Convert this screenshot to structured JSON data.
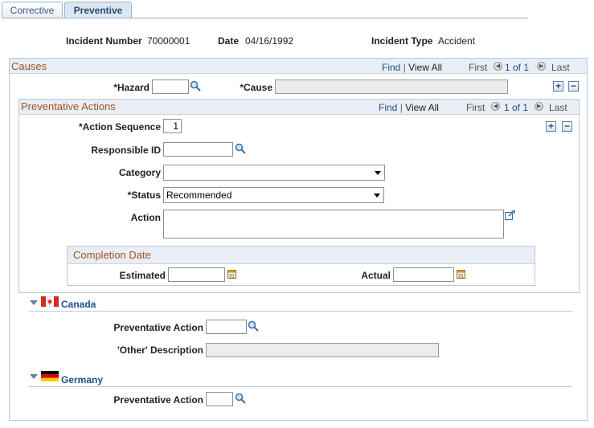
{
  "tabs": [
    {
      "label": "Corrective",
      "active": false
    },
    {
      "label": "Preventive",
      "active": true
    }
  ],
  "header": {
    "incident_number_label": "Incident Number",
    "incident_number_value": "70000001",
    "date_label": "Date",
    "date_value": "04/16/1992",
    "incident_type_label": "Incident Type",
    "incident_type_value": "Accident"
  },
  "causes": {
    "title": "Causes",
    "find": "Find",
    "sep": "|",
    "view_all": "View All",
    "first": "First",
    "count": "1 of 1",
    "last": "Last",
    "hazard_label": "*Hazard",
    "hazard_value": "",
    "cause_label": "*Cause",
    "cause_value": "",
    "add": "+",
    "remove": "−"
  },
  "preventative_actions": {
    "title": "Preventative Actions",
    "find": "Find",
    "sep": "|",
    "view_all": "View All",
    "first": "First",
    "count": "1 of 1",
    "last": "Last",
    "add": "+",
    "remove": "−",
    "action_sequence_label": "*Action Sequence",
    "action_sequence_value": "1",
    "responsible_id_label": "Responsible ID",
    "responsible_id_value": "",
    "category_label": "Category",
    "category_value": "",
    "status_label": "*Status",
    "status_value": "Recommended",
    "action_label": "Action",
    "action_value": "",
    "completion_date": {
      "title": "Completion Date",
      "estimated_label": "Estimated",
      "estimated_value": "",
      "actual_label": "Actual",
      "actual_value": ""
    }
  },
  "canada": {
    "title": "Canada",
    "preventative_action_label": "Preventative Action",
    "preventative_action_value": "",
    "other_description_label": "'Other' Description",
    "other_description_value": ""
  },
  "germany": {
    "title": "Germany",
    "preventative_action_label": "Preventative Action",
    "preventative_action_value": ""
  },
  "colors": {
    "section_title": "#a6521f",
    "link": "#1f4e8c",
    "border": "#b9c9d8"
  },
  "icons": {
    "lookup": "magnifier-icon",
    "calendar": "calendar-icon",
    "expand_text": "expand-text-icon",
    "collapse": "triangle-down-icon",
    "nav_prev": "arrow-left-icon",
    "nav_next": "arrow-right-icon"
  }
}
